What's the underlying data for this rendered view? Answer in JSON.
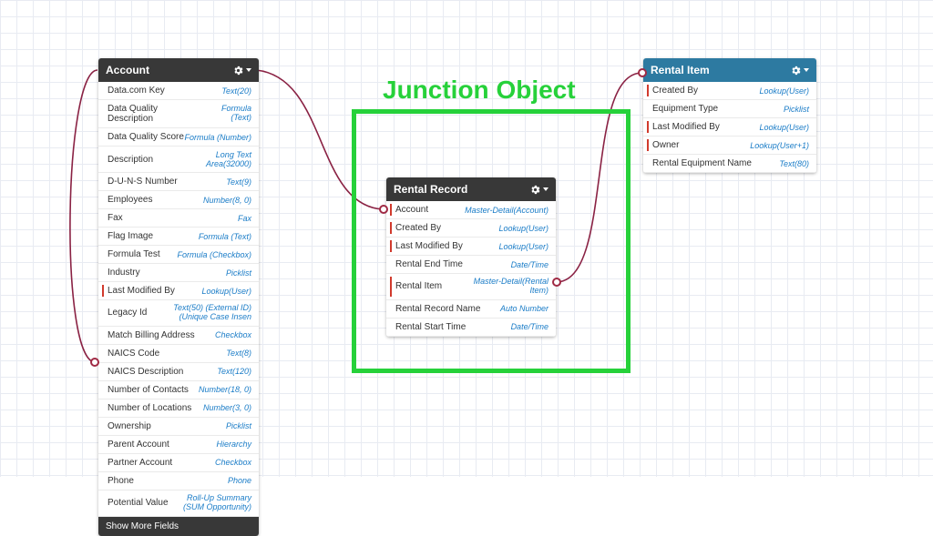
{
  "junction_label": "Junction Object",
  "account": {
    "title": "Account",
    "show_more": "Show More Fields",
    "fields": [
      {
        "label": "Data.com Key",
        "type": "Text(20)"
      },
      {
        "label": "Data Quality Description",
        "type": "Formula (Text)",
        "wrap": true
      },
      {
        "label": "Data Quality Score",
        "type": "Formula (Number)"
      },
      {
        "label": "Description",
        "type": "Long Text Area(32000)"
      },
      {
        "label": "D-U-N-S Number",
        "type": "Text(9)"
      },
      {
        "label": "Employees",
        "type": "Number(8, 0)"
      },
      {
        "label": "Fax",
        "type": "Fax"
      },
      {
        "label": "Flag Image",
        "type": "Formula (Text)"
      },
      {
        "label": "Formula Test",
        "type": "Formula (Checkbox)"
      },
      {
        "label": "Industry",
        "type": "Picklist"
      },
      {
        "label": "Last Modified By",
        "type": "Lookup(User)",
        "req": true
      },
      {
        "label": "Legacy Id",
        "type": "Text(50) (External ID) (Unique Case Insen",
        "wrap": true
      },
      {
        "label": "Match Billing Address",
        "type": "Checkbox"
      },
      {
        "label": "NAICS Code",
        "type": "Text(8)"
      },
      {
        "label": "NAICS Description",
        "type": "Text(120)"
      },
      {
        "label": "Number of Contacts",
        "type": "Number(18, 0)"
      },
      {
        "label": "Number of Locations",
        "type": "Number(3, 0)"
      },
      {
        "label": "Ownership",
        "type": "Picklist"
      },
      {
        "label": "Parent Account",
        "type": "Hierarchy"
      },
      {
        "label": "Partner Account",
        "type": "Checkbox"
      },
      {
        "label": "Phone",
        "type": "Phone"
      },
      {
        "label": "Potential Value",
        "type": "Roll-Up Summary (SUM Opportunity)",
        "wrap": true
      }
    ]
  },
  "rental_record": {
    "title": "Rental Record",
    "fields": [
      {
        "label": "Account",
        "type": "Master-Detail(Account)",
        "req": true
      },
      {
        "label": "Created By",
        "type": "Lookup(User)",
        "req": true
      },
      {
        "label": "Last Modified By",
        "type": "Lookup(User)",
        "req": true
      },
      {
        "label": "Rental End Time",
        "type": "Date/Time"
      },
      {
        "label": "Rental Item",
        "type": "Master-Detail(Rental Item)",
        "req": true,
        "wrap": true
      },
      {
        "label": "Rental Record Name",
        "type": "Auto Number"
      },
      {
        "label": "Rental Start Time",
        "type": "Date/Time"
      }
    ]
  },
  "rental_item": {
    "title": "Rental Item",
    "fields": [
      {
        "label": "Created By",
        "type": "Lookup(User)",
        "req": true
      },
      {
        "label": "Equipment Type",
        "type": "Picklist"
      },
      {
        "label": "Last Modified By",
        "type": "Lookup(User)",
        "req": true
      },
      {
        "label": "Owner",
        "type": "Lookup(User+1)",
        "req": true
      },
      {
        "label": "Rental Equipment Name",
        "type": "Text(80)"
      }
    ]
  }
}
